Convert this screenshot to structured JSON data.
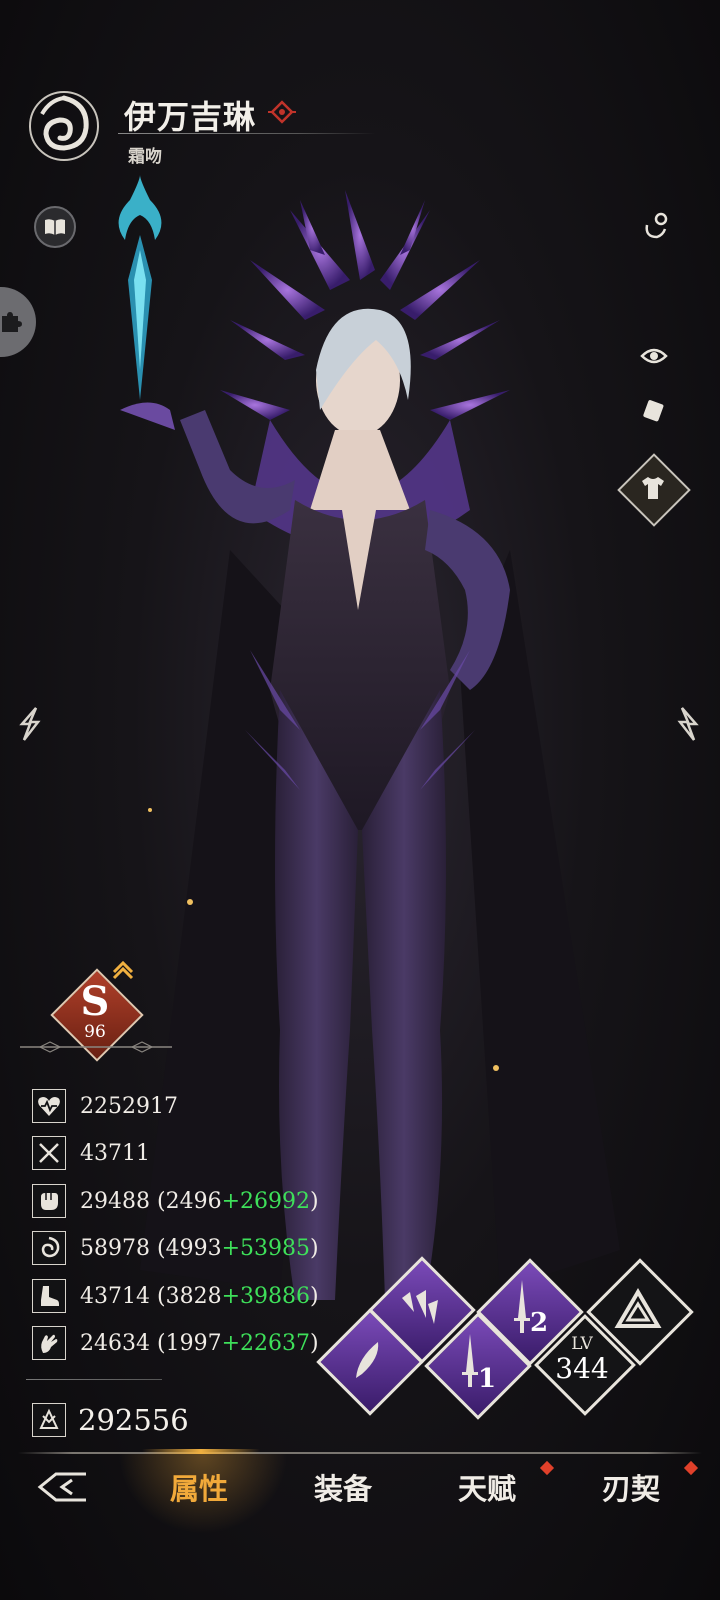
{
  "character": {
    "name": "伊万吉琳",
    "title": "霜吻",
    "grade_letter": "S",
    "grade_level": "96"
  },
  "stats": [
    {
      "icon": "health-icon",
      "total": "2252917",
      "base": "",
      "bonus": ""
    },
    {
      "icon": "crossed-swords-icon",
      "total": "43711",
      "base": "",
      "bonus": ""
    },
    {
      "icon": "fist-icon",
      "total": "29488",
      "base": "2496",
      "bonus": "+26992"
    },
    {
      "icon": "vortex-icon",
      "total": "58978",
      "base": "4993",
      "bonus": "+53985"
    },
    {
      "icon": "boot-icon",
      "total": "43714",
      "base": "3828",
      "bonus": "+39886"
    },
    {
      "icon": "hand-icon",
      "total": "24634",
      "base": "1997",
      "bonus": "+22637"
    }
  ],
  "combat_power": "292556",
  "skills": {
    "slot1_number": "1",
    "slot2_number": "2",
    "level_label": "LV",
    "level_value": "344"
  },
  "nav": {
    "tabs": [
      {
        "label": "属性",
        "active": true
      },
      {
        "label": "装备",
        "active": false
      },
      {
        "label": "天赋",
        "active": false,
        "badge": true
      },
      {
        "label": "刃契",
        "active": false,
        "badge": true
      }
    ]
  },
  "colors": {
    "accent_gold": "#f1a93a",
    "bonus_green": "#3ee05a",
    "skill_purple": "#5a2f96",
    "badge_red": "#e0402a"
  }
}
